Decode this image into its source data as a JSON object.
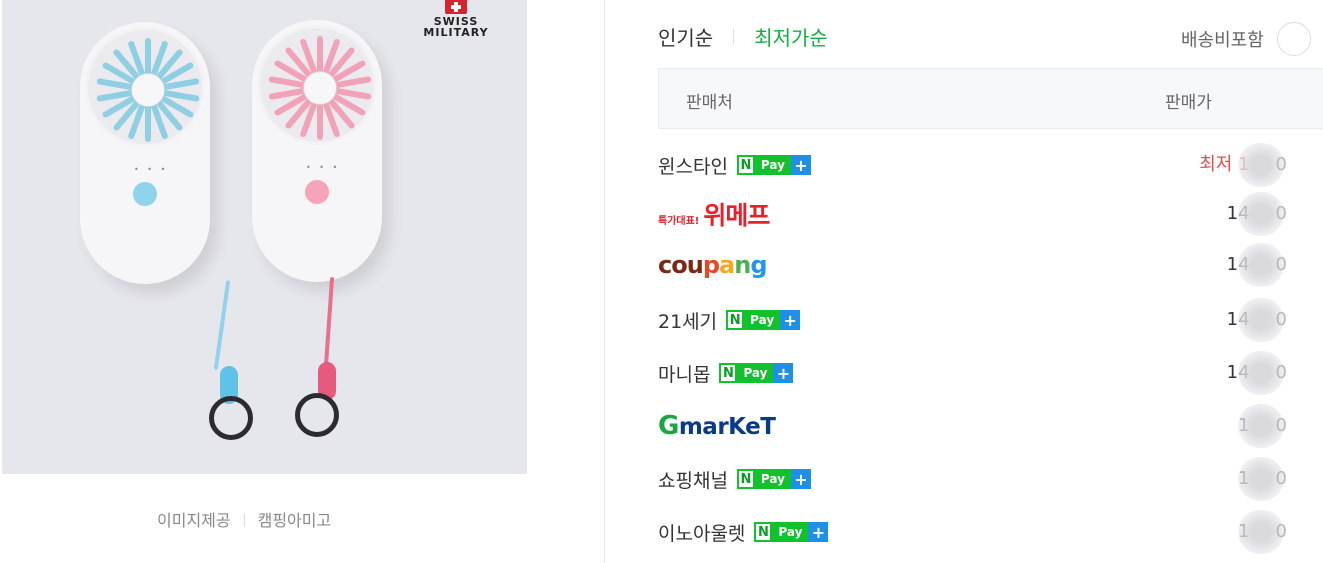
{
  "product": {
    "brand_line1": "SWISS",
    "brand_line2": "MILITARY",
    "image_credit_label": "이미지제공",
    "image_credit_source": "캠핑아미고"
  },
  "sort": {
    "tabs": [
      {
        "label": "인기순",
        "active": false
      },
      {
        "label": "최저가순",
        "active": true
      }
    ],
    "shipping_toggle_label": "배송비포함"
  },
  "table": {
    "headers": {
      "seller": "판매처",
      "price": "판매가"
    }
  },
  "sellers": [
    {
      "name": "윈스타인",
      "logo": null,
      "npay": true,
      "price_prefix": "최저",
      "price_visible": "1",
      "price_tail": "0",
      "lowest": true
    },
    {
      "name": "",
      "logo": "wemakeprice",
      "logo_tag": "특가대표!",
      "logo_text": "위메프",
      "npay": false,
      "price_prefix": "",
      "price_visible": "14",
      "price_tail": "0",
      "lowest": false
    },
    {
      "name": "",
      "logo": "coupang",
      "logo_text": "coupang",
      "npay": false,
      "price_prefix": "",
      "price_visible": "14",
      "price_tail": "0",
      "lowest": false
    },
    {
      "name": "21세기",
      "logo": null,
      "npay": true,
      "price_prefix": "",
      "price_visible": "14",
      "price_tail": "0",
      "lowest": false
    },
    {
      "name": "마니몹",
      "logo": null,
      "npay": true,
      "price_prefix": "",
      "price_visible": "14",
      "price_tail": "0",
      "lowest": false
    },
    {
      "name": "",
      "logo": "gmarket",
      "logo_g": "G",
      "logo_text": "marKeT",
      "npay": false,
      "price_prefix": "",
      "price_visible": "1",
      "price_tail": "0",
      "lowest": false
    },
    {
      "name": "쇼핑채널",
      "logo": null,
      "npay": true,
      "price_prefix": "",
      "price_visible": "1",
      "price_tail": "0",
      "lowest": false
    },
    {
      "name": "이노아울렛",
      "logo": null,
      "npay": true,
      "price_prefix": "",
      "price_visible": "1",
      "price_tail": "0",
      "lowest": false
    }
  ],
  "npay_badge": {
    "n": "N",
    "pay": "Pay",
    "plus": "+"
  },
  "colors": {
    "accent_green": "#11b142",
    "lowest_red": "#e94a4a",
    "npay_green": "#11c22c",
    "npay_blue": "#1e90e8"
  }
}
